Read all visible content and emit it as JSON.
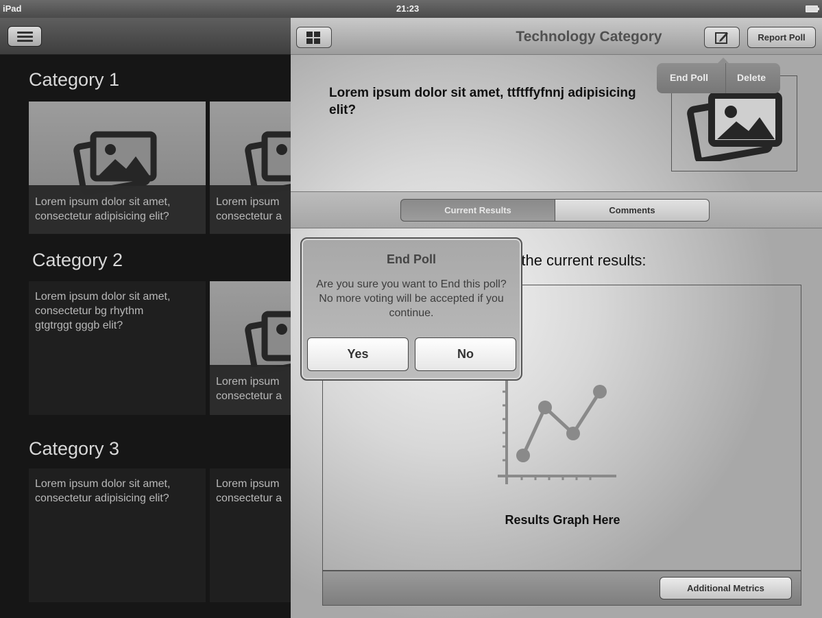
{
  "status_bar": {
    "carrier": "iPad",
    "time": "21:23"
  },
  "sidebar": {
    "categories": [
      {
        "title": "Category 1",
        "tiles": [
          {
            "lines": [
              "Lorem ipsum dolor sit amet,",
              "consectetur adipisicing elit?"
            ]
          },
          {
            "lines": [
              "Lorem ipsum",
              "consectetur a"
            ]
          }
        ]
      },
      {
        "title": "Category 2",
        "tiles": [
          {
            "lines": [
              "Lorem ipsum dolor sit amet,",
              "consectetur bg rhythm",
              "gtgtrggt gggb elit?"
            ]
          },
          {
            "lines": [
              "Lorem ipsum",
              "consectetur a"
            ]
          }
        ]
      },
      {
        "title": "Category 3",
        "tiles": [
          {
            "lines": [
              "Lorem ipsum dolor sit amet,",
              "consectetur adipisicing elit?"
            ]
          },
          {
            "lines": [
              "Lorem ipsum",
              "consectetur a"
            ]
          }
        ]
      }
    ]
  },
  "detail": {
    "title": "Technology Category",
    "report_label": "Report Poll",
    "popover": {
      "end_poll": "End Poll",
      "delete": "Delete"
    },
    "question": "Lorem ipsum dolor sit amet, ttftffyfnnj adipisicing elit?",
    "tabs": {
      "current": "Current Results",
      "comments": "Comments"
    },
    "results_label": "e the current results:",
    "graph_caption": "Results Graph Here",
    "metrics_label": "Additional Metrics"
  },
  "alert": {
    "title": "End Poll",
    "message": "Are you sure you want to End this poll? No more voting will be accepted if you continue.",
    "yes": "Yes",
    "no": "No"
  }
}
